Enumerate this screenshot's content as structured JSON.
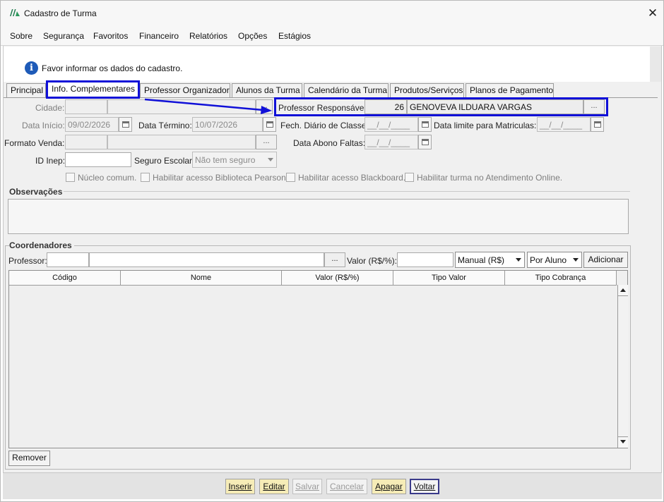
{
  "window": {
    "title": "Cadastro de Turma",
    "close_glyph": "✕"
  },
  "menu": [
    "Sobre",
    "Segurança",
    "Favoritos",
    "Financeiro",
    "Relatórios",
    "Opções",
    "Estágios"
  ],
  "info": {
    "icon": "info-icon",
    "message": "Favor informar os dados do cadastro."
  },
  "tabs": [
    "Principal",
    "Info. Complementares",
    "Professor Organizador",
    "Alunos da Turma",
    "Calendário da Turma",
    "Produtos/Serviços",
    "Planos de Pagamento"
  ],
  "active_tab": "Info. Complementares",
  "form": {
    "cidade_label": "Cidade:",
    "cidade_code": "",
    "cidade_name": "",
    "lookup": "...",
    "professor_resp_label": "Professor Responsável:",
    "professor_resp_code": "26",
    "professor_resp_name": "GENOVEVA ILDUARA VARGAS",
    "data_inicio_label": "Data Início:",
    "data_inicio": "09/02/2026",
    "data_termino_label": "Data Término:",
    "data_termino": "10/07/2026",
    "fech_diario_label": "Fech. Diário de Classe:",
    "fech_diario": "__/__/____",
    "data_limite_label": "Data limite para Matriculas:",
    "data_limite": "__/__/____",
    "formato_venda_label": "Formato Venda:",
    "formato_venda_code": "",
    "formato_venda_name": "",
    "data_abono_label": "Data Abono Faltas:",
    "data_abono": "__/__/____",
    "id_inep_label": "ID Inep:",
    "id_inep": "",
    "seguro_label": "Seguro Escolar:",
    "seguro_value": "Não tem seguro",
    "checkboxes": [
      "Núcleo comum.",
      "Habilitar acesso Biblioteca Pearson.",
      "Habilitar acesso Blackboard.",
      "Habilitar turma no Atendimento Online."
    ]
  },
  "observacoes": {
    "title": "Observações",
    "value": ""
  },
  "coordenadores": {
    "title": "Coordenadores",
    "professor_label": "Professor:",
    "professor_code": "",
    "professor_name": "",
    "lookup": "...",
    "valor_label": "Valor (R$/%):",
    "valor": "",
    "tipo_valor": "Manual (R$)",
    "tipo_cobranca": "Por Aluno",
    "add_label": "Adicionar",
    "columns": [
      "Código",
      "Nome",
      "Valor (R$/%)",
      "Tipo Valor",
      "Tipo Cobrança"
    ],
    "rows": [],
    "remove_label": "Remover"
  },
  "footer": {
    "inserir": "Inserir",
    "editar": "Editar",
    "salvar": "Salvar",
    "cancelar": "Cancelar",
    "apagar": "Apagar",
    "voltar": "Voltar"
  },
  "colors": {
    "annotation": "#1010d8",
    "action_button": "#f6ecb7",
    "info_icon": "#1e5bb8"
  }
}
